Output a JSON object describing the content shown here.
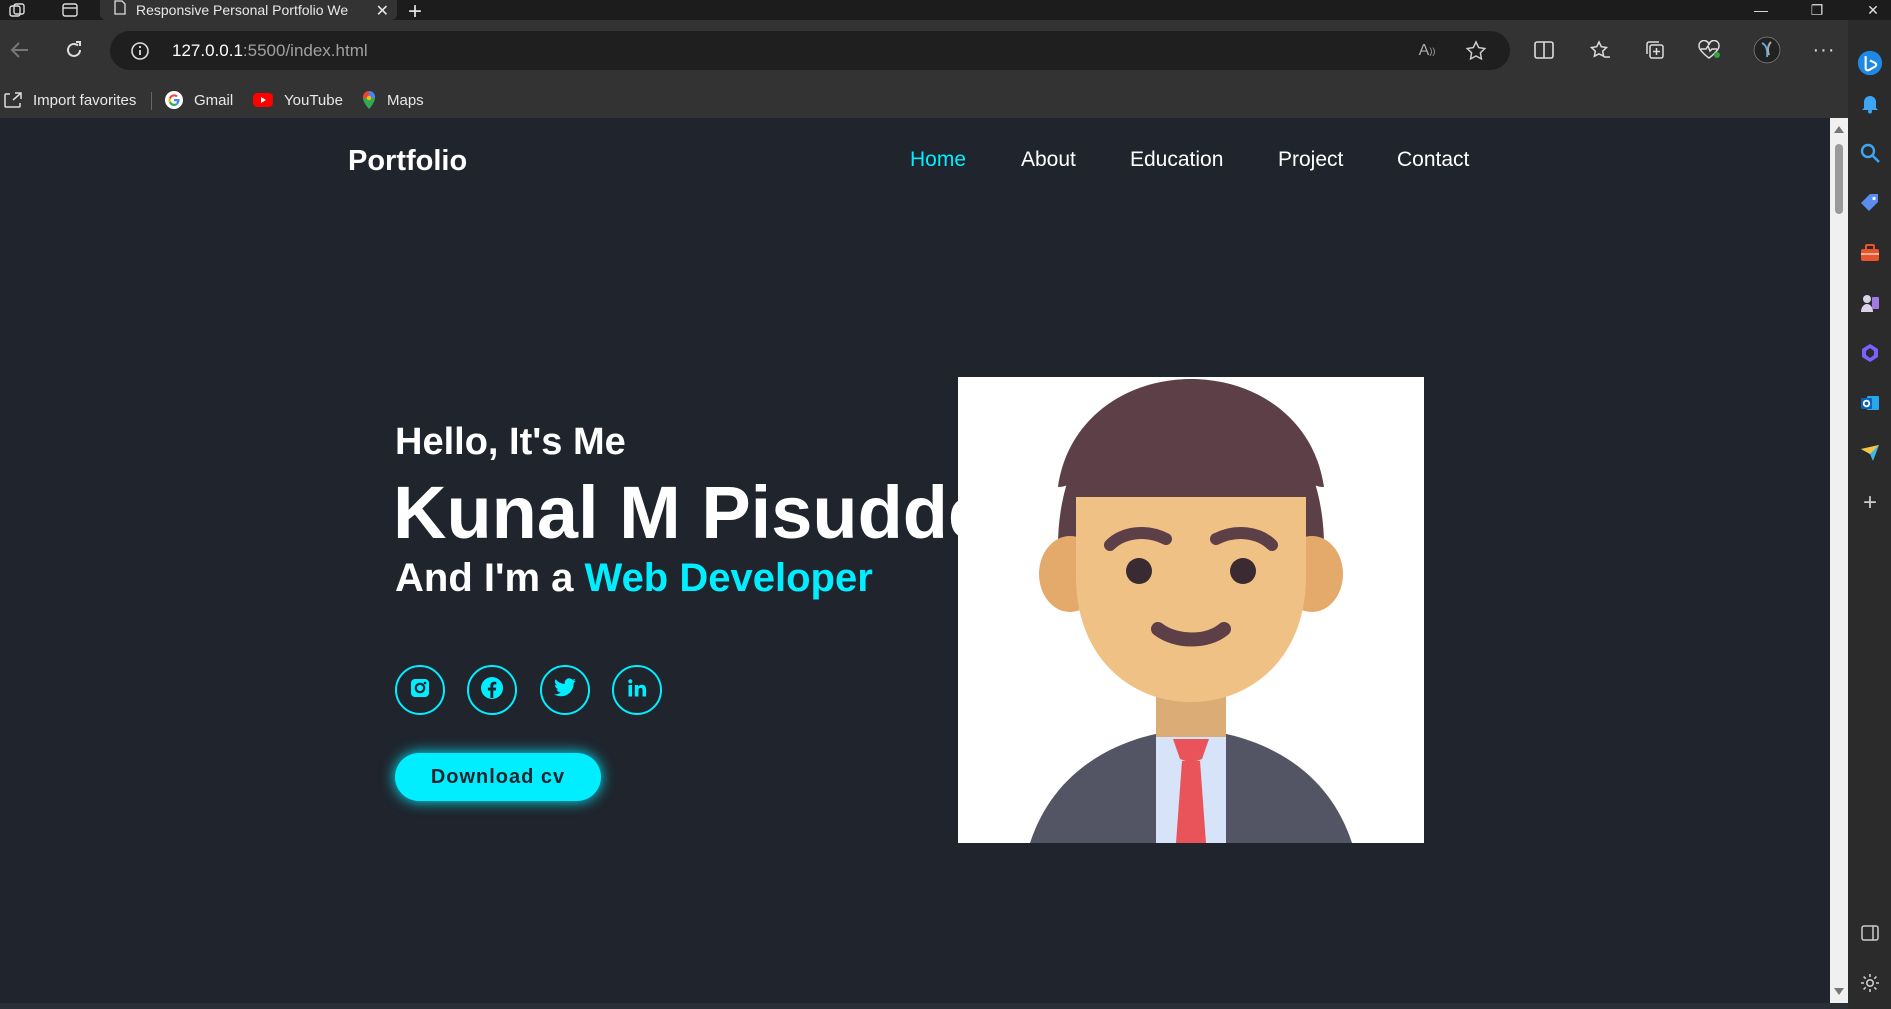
{
  "browser": {
    "tab_title": "Responsive Personal Portfolio We",
    "url_host": "127.0.0.1",
    "url_path": ":5500/index.html",
    "favorites": [
      {
        "label": "Import favorites",
        "icon": "import-icon"
      },
      {
        "label": "Gmail",
        "icon": "google-icon"
      },
      {
        "label": "YouTube",
        "icon": "youtube-icon"
      },
      {
        "label": "Maps",
        "icon": "maps-icon"
      }
    ]
  },
  "page": {
    "logo": "Portfolio",
    "nav": [
      {
        "label": "Home",
        "active": true
      },
      {
        "label": "About",
        "active": false
      },
      {
        "label": "Education",
        "active": false
      },
      {
        "label": "Project",
        "active": false
      },
      {
        "label": "Contact",
        "active": false
      }
    ],
    "hero": {
      "greeting": "Hello, It's Me",
      "name": "Kunal M Pisudde",
      "role_prefix": "And I'm a ",
      "role_accent": "Web Developer",
      "cta": "Download cv"
    },
    "social": [
      "instagram-icon",
      "facebook-icon",
      "twitter-icon",
      "linkedin-icon"
    ],
    "colors": {
      "accent": "#00eeff",
      "background": "#1f242d"
    }
  }
}
